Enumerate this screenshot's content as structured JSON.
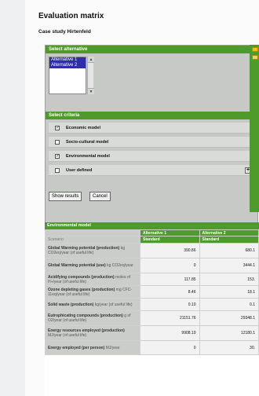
{
  "page": {
    "title": "Evaluation matrix",
    "subtitle": "Case study Hirtenfeld"
  },
  "alternatives_panel": {
    "header": "Select alternative",
    "options": [
      "Alternative 1",
      "Alternative 2"
    ]
  },
  "criteria_panel": {
    "header": "Select criteria",
    "items": [
      {
        "label": "Economic model",
        "checked": true
      },
      {
        "label": "Socio-cultural model",
        "checked": false
      },
      {
        "label": "Environmental model",
        "checked": true
      },
      {
        "label": "User defined",
        "checked": false
      }
    ],
    "add_symbol": "+"
  },
  "buttons": {
    "show_results": "Show results",
    "cancel": "Cancel"
  },
  "table": {
    "title": "Environmental model",
    "columns": [
      "Alternative 1",
      "Alternative 2"
    ],
    "scenario_label": "Scenario",
    "scenario_values": [
      "Standard",
      "Standard"
    ],
    "rows": [
      {
        "name": "Global Warming potential (production)",
        "unit": "kg CO2eq/year (of useful life)",
        "values": [
          "390.86",
          "680.1"
        ]
      },
      {
        "name": "Global Warming potential (use)",
        "unit": "kg CO2eq/year",
        "values": [
          "0",
          "3444.1"
        ]
      },
      {
        "name": "Acidifying compounds (production)",
        "unit": "moles of H+/year (of useful life)",
        "values": [
          "117.85",
          "153."
        ]
      },
      {
        "name": "Ozone depleting gases (production)",
        "unit": "mg CFC-11eq/year (of useful life)",
        "values": [
          "8.46",
          "18.1"
        ]
      },
      {
        "name": "Solid waste (production)",
        "unit": "kg/year (of useful life)",
        "values": [
          "0.10",
          "0.1"
        ]
      },
      {
        "name": "Eutrophicating compounds (production)",
        "unit": "g of O2/year (of useful life)",
        "values": [
          "21151.76",
          "29348.1"
        ]
      },
      {
        "name": "Energy resources employed (production)",
        "unit": "MJ/year (of useful life)",
        "values": [
          "9908.19",
          "12180.1"
        ]
      },
      {
        "name": "Energy employed (per person)",
        "unit": "MJ/year",
        "values": [
          "0",
          "30."
        ]
      }
    ]
  }
}
